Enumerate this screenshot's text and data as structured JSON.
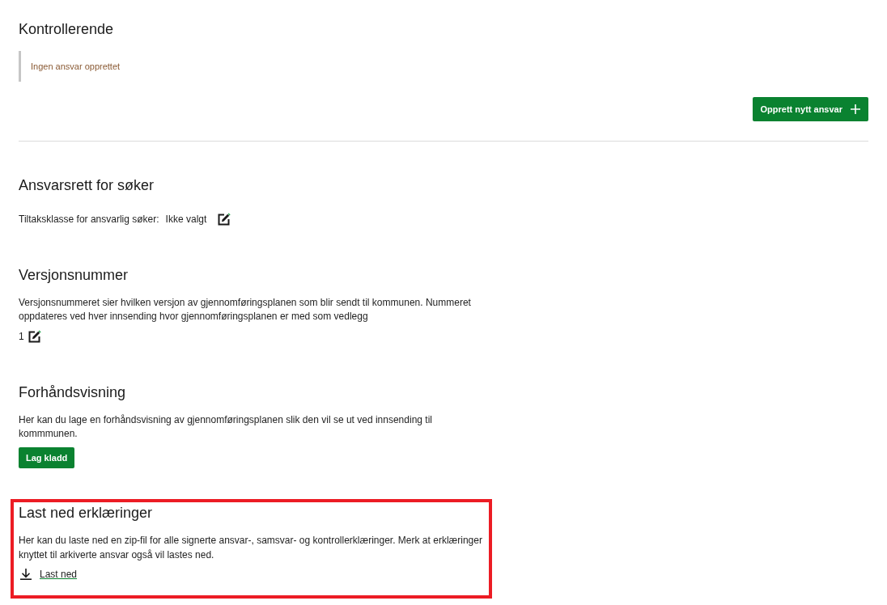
{
  "control_section": {
    "title": "Kontrollerende",
    "notice": "Ingen ansvar opprettet",
    "create_button": "Opprett nytt ansvar"
  },
  "applicant_section": {
    "title": "Ansvarsrett for søker",
    "field_label": "Tiltaksklasse for ansvarlig søker:",
    "field_value": "Ikke valgt"
  },
  "version_section": {
    "title": "Versjonsnummer",
    "description": "Versjonsnummeret sier hvilken versjon av gjennomføringsplanen som blir sendt til kommunen. Nummeret oppdateres ved hver innsending hvor gjennomføringsplanen er med som vedlegg",
    "value": "1"
  },
  "preview_section": {
    "title": "Forhåndsvisning",
    "description": "Her kan du lage en forhåndsvisning av gjennomføringsplanen slik den vil se ut ved innsending til kommmunen.",
    "button": "Lag kladd"
  },
  "download_section": {
    "title": "Last ned erklæringer",
    "description": "Her kan du laste ned en zip-fil for alle signerte ansvar-, samsvar- og kontrollerklæringer. Merk at erklæringer knyttet til arkiverte ansvar også vil lastes ned.",
    "link": "Last ned",
    "highlighted": true
  }
}
